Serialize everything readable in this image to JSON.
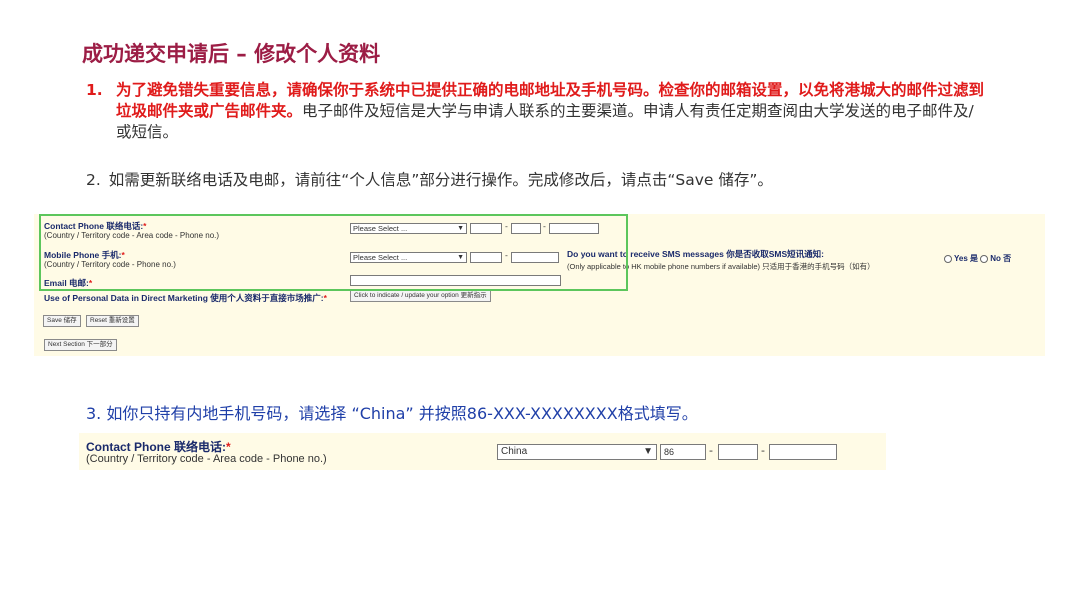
{
  "slide": {
    "title": "成功递交申请后 – 修改个人资料",
    "item1": {
      "number": "1.",
      "red_text": "为了避免错失重要信息，请确保你于系统中已提供正确的电邮地址及手机号码。检查你的邮箱设置，以免将港城大的邮件过滤到垃圾邮件夹或广告邮件夹。",
      "normal_text": "电子邮件及短信是大学与申请人联系的主要渠道。申请人有责任定期查阅由大学发送的电子邮件及/或短信。"
    },
    "item2": {
      "number": "2.",
      "text": "如需更新联络电话及电邮，请前往“个人信息”部分进行操作。完成修改后，请点击“Save 储存”。"
    },
    "item3": {
      "text": "3. 如你只持有内地手机号码，请选择 “China” 并按照86-XXX-XXXXXXXX格式填写。"
    }
  },
  "form1": {
    "contact_label": "Contact Phone 联络电话:",
    "contact_sub": "(Country / Territory code - Area code - Phone no.)",
    "contact_select": "Please Select ...",
    "mobile_label": "Mobile Phone 手机:",
    "mobile_sub": "(Country / Territory code - Phone no.)",
    "mobile_select": "Please Select ...",
    "sms_question": "Do you want to receive SMS messages 你是否收取SMS短讯通知:",
    "sms_note": "(Only applicable to HK mobile phone numbers if available) 只适用于香港的手机号码（如有）",
    "sms_yes": "Yes 是",
    "sms_no": "No 否",
    "email_label": "Email 电邮:",
    "marketing_label": "Use of Personal Data in Direct Marketing 使用个人资料于直接市场推广:",
    "marketing_button": "Click to indicate / update your option 更新指示",
    "save_button": "Save 储存",
    "reset_button": "Reset 重新设置",
    "next_button": "Next Section 下一部分",
    "required_mark": "*",
    "dash": "-"
  },
  "form2": {
    "contact_label": "Contact Phone 联络电话:",
    "contact_sub": "(Country / Territory code - Area code - Phone no.)",
    "country_value": "China",
    "country_code_value": "86",
    "required_mark": "*",
    "dash": "-"
  },
  "colors": {
    "title": "#9c1d45",
    "red": "#e01b1b",
    "blue_text": "#1f3fa8",
    "panel_bg": "#fffbe6",
    "highlight_box": "#5cc65c"
  }
}
